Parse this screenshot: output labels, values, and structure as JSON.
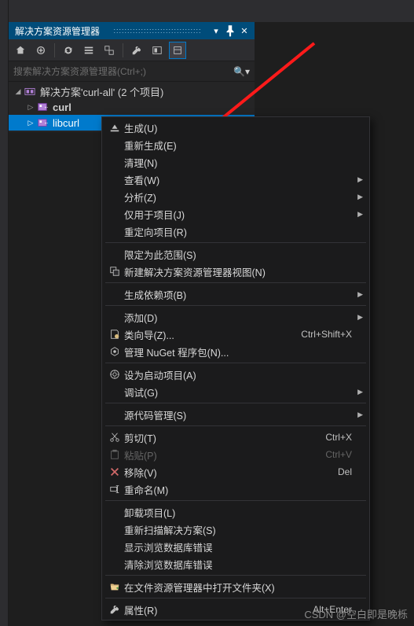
{
  "panel": {
    "title": "解决方案资源管理器"
  },
  "search": {
    "placeholder": "搜索解决方案资源管理器(Ctrl+;)"
  },
  "tree": {
    "solution": "解决方案'curl-all' (2 个项目)",
    "items": [
      {
        "label": "curl"
      },
      {
        "label": "libcurl"
      }
    ]
  },
  "menu": {
    "groups": [
      [
        {
          "label": "生成(U)",
          "icon": "build"
        },
        {
          "label": "重新生成(E)"
        },
        {
          "label": "清理(N)"
        },
        {
          "label": "查看(W)",
          "submenu": true
        },
        {
          "label": "分析(Z)",
          "submenu": true
        },
        {
          "label": "仅用于项目(J)",
          "submenu": true
        },
        {
          "label": "重定向项目(R)"
        }
      ],
      [
        {
          "label": "限定为此范围(S)"
        },
        {
          "label": "新建解决方案资源管理器视图(N)",
          "icon": "new-view"
        }
      ],
      [
        {
          "label": "生成依赖项(B)",
          "submenu": true
        }
      ],
      [
        {
          "label": "添加(D)",
          "submenu": true
        },
        {
          "label": "类向导(Z)...",
          "icon": "class-wizard",
          "shortcut": "Ctrl+Shift+X"
        },
        {
          "label": "管理 NuGet 程序包(N)...",
          "icon": "nuget"
        }
      ],
      [
        {
          "label": "设为启动项目(A)",
          "icon": "startup"
        },
        {
          "label": "调试(G)",
          "submenu": true
        }
      ],
      [
        {
          "label": "源代码管理(S)",
          "submenu": true
        }
      ],
      [
        {
          "label": "剪切(T)",
          "icon": "cut",
          "shortcut": "Ctrl+X"
        },
        {
          "label": "粘贴(P)",
          "icon": "paste",
          "shortcut": "Ctrl+V",
          "disabled": true
        },
        {
          "label": "移除(V)",
          "icon": "remove",
          "shortcut": "Del"
        },
        {
          "label": "重命名(M)",
          "icon": "rename"
        }
      ],
      [
        {
          "label": "卸载项目(L)"
        },
        {
          "label": "重新扫描解决方案(S)"
        },
        {
          "label": "显示浏览数据库错误"
        },
        {
          "label": "清除浏览数据库错误"
        }
      ],
      [
        {
          "label": "在文件资源管理器中打开文件夹(X)",
          "icon": "open-folder"
        }
      ],
      [
        {
          "label": "属性(R)",
          "icon": "properties",
          "shortcut": "Alt+Enter"
        }
      ]
    ]
  },
  "watermark": "CSDN @空白即是晚栎"
}
